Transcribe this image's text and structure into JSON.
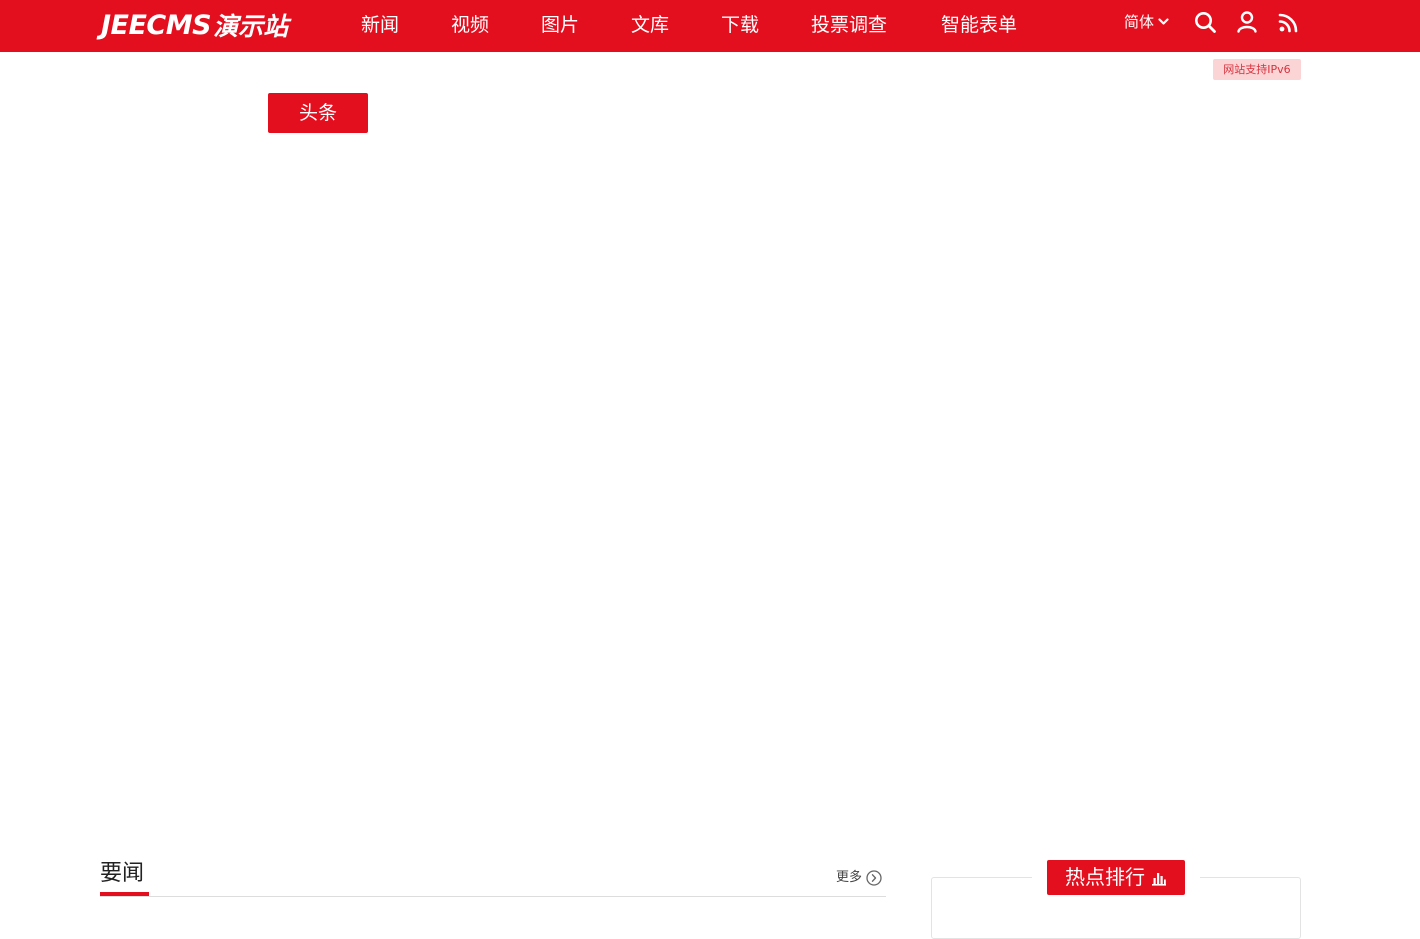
{
  "header": {
    "logo_en": "JEECMS",
    "logo_cn": "演示站",
    "nav": [
      {
        "label": "新闻"
      },
      {
        "label": "视频"
      },
      {
        "label": "图片"
      },
      {
        "label": "文库"
      },
      {
        "label": "下载"
      },
      {
        "label": "投票调查"
      },
      {
        "label": "智能表单"
      }
    ],
    "language": "简体",
    "icons": [
      "search-icon",
      "user-icon",
      "rss-icon"
    ],
    "ipv6_badge": "网站支持IPv6"
  },
  "headline": {
    "button_label": "头条"
  },
  "news_section": {
    "title": "要闻",
    "more_label": "更多"
  },
  "hot_ranking": {
    "title": "热点排行"
  },
  "colors": {
    "brand": "#e30f1f",
    "badge_bg": "#fbd4d6",
    "badge_text": "#d7323d"
  }
}
